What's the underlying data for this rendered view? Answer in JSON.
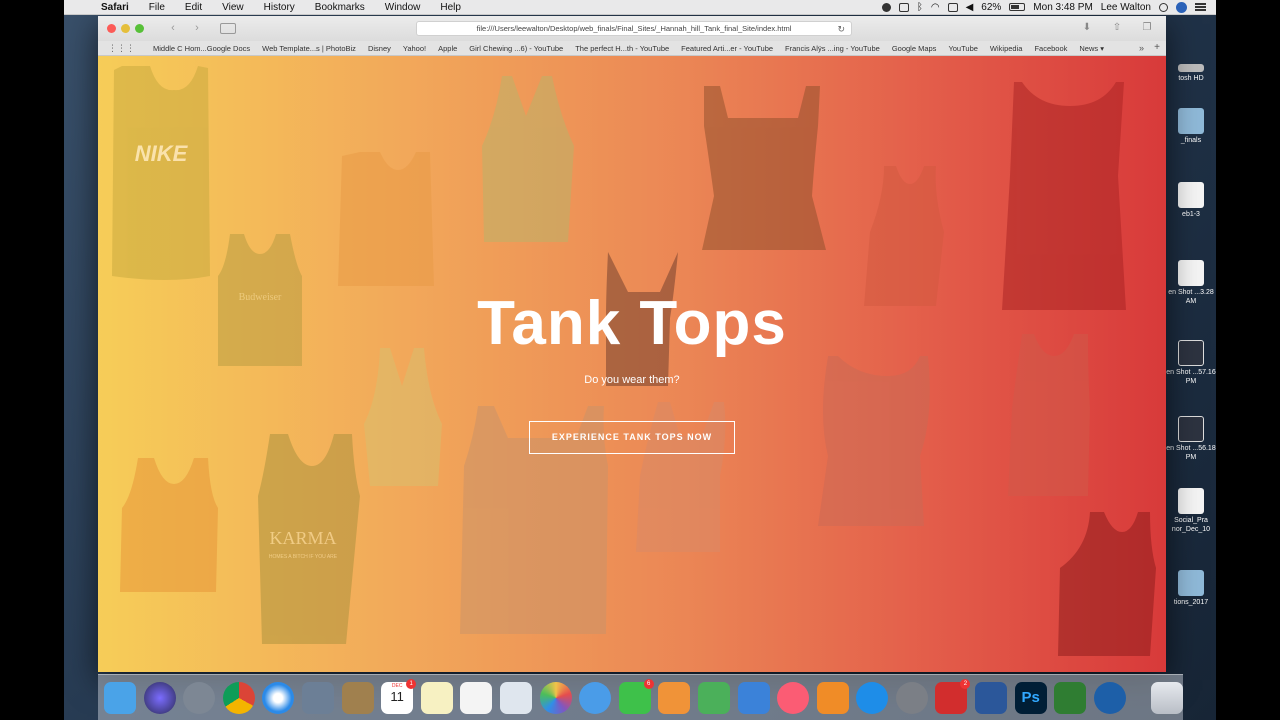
{
  "menubar": {
    "app_name": "Safari",
    "items": [
      "File",
      "Edit",
      "View",
      "History",
      "Bookmarks",
      "Window",
      "Help"
    ],
    "battery": "62%",
    "clock": "Mon 3:48 PM",
    "user": "Lee Walton"
  },
  "browser": {
    "url": "file:///Users/leewalton/Desktop/web_finals/Final_Sites/_Hannah_hill_Tank_final_Site/index.html",
    "favorites": [
      "Middle C Hom...Google Docs",
      "Web Template...s | PhotoBiz",
      "Disney",
      "Yahoo!",
      "Apple",
      "Girl Chewing ...6) - YouTube",
      "The perfect H...th - YouTube",
      "Featured Arti...er - YouTube",
      "Francis Alÿs ...ing - YouTube",
      "Google Maps",
      "YouTube",
      "Wikipedia",
      "Facebook",
      "News ▾"
    ]
  },
  "page": {
    "title": "Tank Tops",
    "subtitle": "Do you wear them?",
    "cta": "EXPERIENCE TANK TOPS NOW",
    "shirt_prints": {
      "nike": "NIKE",
      "bud": "Budweiser",
      "karma": "KARMA",
      "karma_sub": "HOMES A BITCH IF YOU ARE"
    }
  },
  "desktop": {
    "icons": [
      "tosh HD",
      "_finals",
      "eb1-3",
      "en Shot ...3.28 AM",
      "en Shot ...57.16 PM",
      "en Shot ...56.18 PM",
      "Social_Pra nor_Dec_10",
      "tions_2017"
    ]
  },
  "dock": {
    "calendar_month": "DEC",
    "calendar_day": "11",
    "badge_1": "1",
    "badge_6": "6",
    "badge_2": "2",
    "photoshop": "Ps"
  }
}
